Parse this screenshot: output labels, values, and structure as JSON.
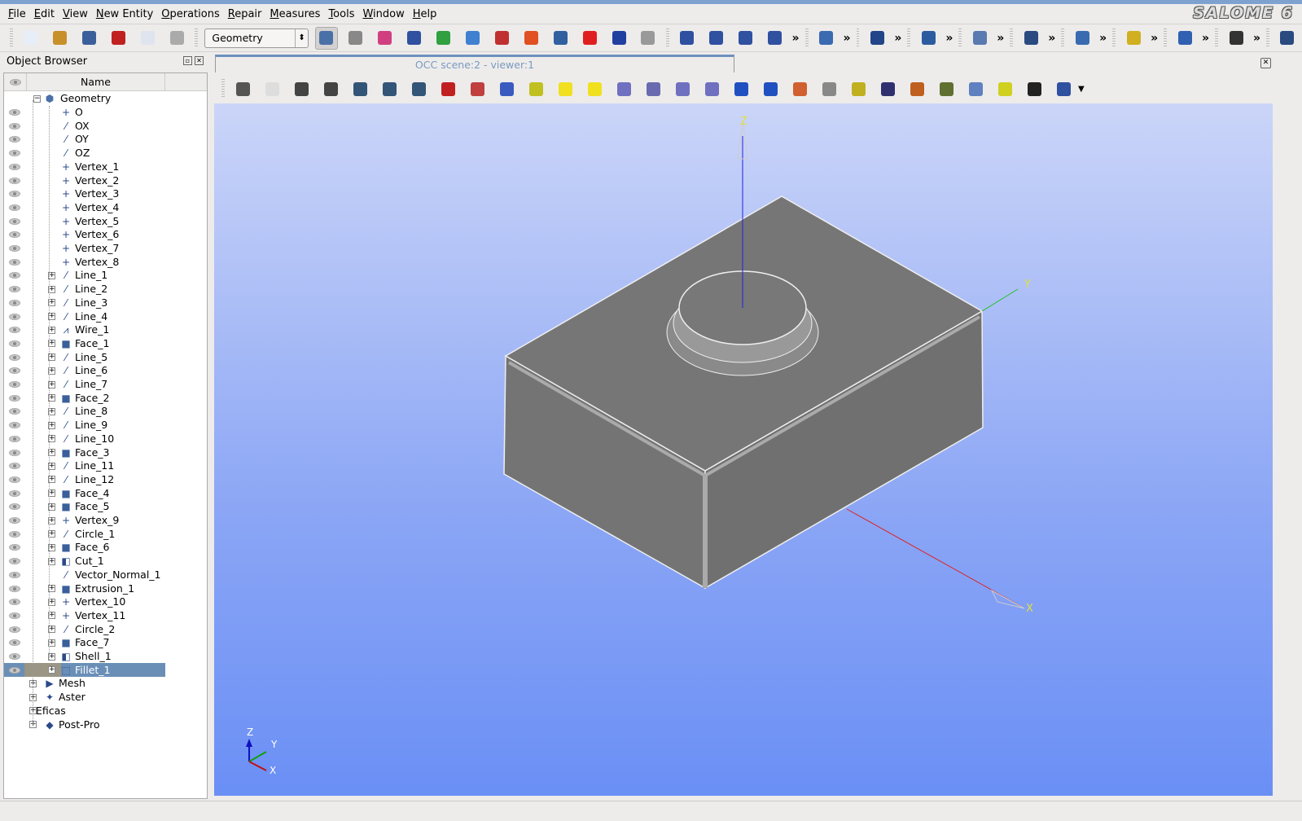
{
  "menu": [
    "File",
    "Edit",
    "View",
    "New Entity",
    "Operations",
    "Repair",
    "Measures",
    "Tools",
    "Window",
    "Help"
  ],
  "logo": "SALOME 6",
  "toolbar": {
    "file_icons": [
      {
        "name": "new-document-icon",
        "color": "#e8eef8"
      },
      {
        "name": "open-folder-icon",
        "color": "#c8902a"
      },
      {
        "name": "save-icon",
        "color": "#3b5f9a"
      },
      {
        "name": "close-icon",
        "color": "#c02020"
      },
      {
        "name": "copy-icon",
        "color": "#dfe4ee"
      },
      {
        "name": "paste-icon",
        "color": "#aaaaaa"
      }
    ],
    "module_select": "Geometry",
    "module_icons": [
      {
        "name": "geometry-module-icon",
        "color": "#4a70a8"
      },
      {
        "name": "smesh-module-icon",
        "color": "#888888"
      },
      {
        "name": "post-pro-module-icon",
        "color": "#d04080"
      },
      {
        "name": "yacs-module-icon",
        "color": "#3050a0"
      },
      {
        "name": "paravis-module-icon",
        "color": "#30a040"
      },
      {
        "name": "light-module-icon",
        "color": "#4080d0"
      },
      {
        "name": "homard-module-icon",
        "color": "#c03030"
      },
      {
        "name": "eficas-module-icon",
        "color": "#e05020"
      },
      {
        "name": "aster-module-icon",
        "color": "#3060a0"
      },
      {
        "name": "lobster-module-icon",
        "color": "#e02020"
      },
      {
        "name": "epx-module-icon",
        "color": "#2040a0"
      },
      {
        "name": "calculator-icon",
        "color": "#999999"
      }
    ],
    "geom_icons": [
      {
        "name": "point-icon",
        "color": "#3050a0"
      },
      {
        "name": "line-icon",
        "color": "#3050a0"
      },
      {
        "name": "circle-icon",
        "color": "#3050a0"
      },
      {
        "name": "plane-icon",
        "color": "#3050a0"
      },
      {
        "name": "box-icon",
        "color": "#3a6ab0"
      },
      {
        "name": "sphere-mesh-icon",
        "color": "#224488"
      },
      {
        "name": "boolean-icon",
        "color": "#2c5ca0"
      },
      {
        "name": "partition-icon",
        "color": "#5a7ab0"
      },
      {
        "name": "transform-icon",
        "color": "#2a4a80"
      },
      {
        "name": "solid-icon",
        "color": "#3a6ab0"
      },
      {
        "name": "fillet-2d-icon",
        "color": "#d0b020"
      },
      {
        "name": "edge-icon",
        "color": "#3060b0"
      },
      {
        "name": "vertex-small-icon",
        "color": "#333333"
      },
      {
        "name": "picture-icon",
        "color": "#2a4a80"
      }
    ],
    "more": "»"
  },
  "object_browser": {
    "title": "Object Browser",
    "column_name": "Name",
    "root": "Geometry",
    "children": [
      {
        "label": "O",
        "icon": "vertex",
        "expandable": false
      },
      {
        "label": "OX",
        "icon": "vector",
        "expandable": false
      },
      {
        "label": "OY",
        "icon": "vector",
        "expandable": false
      },
      {
        "label": "OZ",
        "icon": "vector",
        "expandable": false
      },
      {
        "label": "Vertex_1",
        "icon": "vertex",
        "expandable": false
      },
      {
        "label": "Vertex_2",
        "icon": "vertex",
        "expandable": false
      },
      {
        "label": "Vertex_3",
        "icon": "vertex",
        "expandable": false
      },
      {
        "label": "Vertex_4",
        "icon": "vertex",
        "expandable": false
      },
      {
        "label": "Vertex_5",
        "icon": "vertex",
        "expandable": false
      },
      {
        "label": "Vertex_6",
        "icon": "vertex",
        "expandable": false
      },
      {
        "label": "Vertex_7",
        "icon": "vertex",
        "expandable": false
      },
      {
        "label": "Vertex_8",
        "icon": "vertex",
        "expandable": false
      },
      {
        "label": "Line_1",
        "icon": "line",
        "expandable": true
      },
      {
        "label": "Line_2",
        "icon": "line",
        "expandable": true
      },
      {
        "label": "Line_3",
        "icon": "line",
        "expandable": true
      },
      {
        "label": "Line_4",
        "icon": "line",
        "expandable": true
      },
      {
        "label": "Wire_1",
        "icon": "wire",
        "expandable": true
      },
      {
        "label": "Face_1",
        "icon": "face",
        "expandable": true
      },
      {
        "label": "Line_5",
        "icon": "line",
        "expandable": true
      },
      {
        "label": "Line_6",
        "icon": "line",
        "expandable": true
      },
      {
        "label": "Line_7",
        "icon": "line",
        "expandable": true
      },
      {
        "label": "Face_2",
        "icon": "face",
        "expandable": true
      },
      {
        "label": "Line_8",
        "icon": "line",
        "expandable": true
      },
      {
        "label": "Line_9",
        "icon": "line",
        "expandable": true
      },
      {
        "label": "Line_10",
        "icon": "line",
        "expandable": true
      },
      {
        "label": "Face_3",
        "icon": "face",
        "expandable": true
      },
      {
        "label": "Line_11",
        "icon": "line",
        "expandable": true
      },
      {
        "label": "Line_12",
        "icon": "line",
        "expandable": true
      },
      {
        "label": "Face_4",
        "icon": "face",
        "expandable": true
      },
      {
        "label": "Face_5",
        "icon": "face",
        "expandable": true
      },
      {
        "label": "Vertex_9",
        "icon": "vertex",
        "expandable": true
      },
      {
        "label": "Circle_1",
        "icon": "line",
        "expandable": true
      },
      {
        "label": "Face_6",
        "icon": "face",
        "expandable": true
      },
      {
        "label": "Cut_1",
        "icon": "solid",
        "expandable": true
      },
      {
        "label": "Vector_Normal_1",
        "icon": "vector",
        "expandable": false
      },
      {
        "label": "Extrusion_1",
        "icon": "face",
        "expandable": true
      },
      {
        "label": "Vertex_10",
        "icon": "vertex",
        "expandable": true
      },
      {
        "label": "Vertex_11",
        "icon": "vertex",
        "expandable": true
      },
      {
        "label": "Circle_2",
        "icon": "line",
        "expandable": true
      },
      {
        "label": "Face_7",
        "icon": "face",
        "expandable": true
      },
      {
        "label": "Shell_1",
        "icon": "solid",
        "expandable": true
      },
      {
        "label": "Fillet_1",
        "icon": "fillet",
        "expandable": true,
        "selected": true
      }
    ],
    "modules": [
      {
        "label": "Mesh",
        "icon": "mesh"
      },
      {
        "label": "Aster",
        "icon": "aster"
      },
      {
        "label": "Eficas",
        "icon": ""
      },
      {
        "label": "Post-Pro",
        "icon": "postpro"
      }
    ]
  },
  "viewer": {
    "tab_title": "OCC scene:2 - viewer:1",
    "tools": [
      {
        "name": "dump-view-icon",
        "color": "#555555"
      },
      {
        "name": "mouse-mode-icon",
        "color": "#dddddd"
      },
      {
        "name": "show-trihedron-icon",
        "color": "#444444"
      },
      {
        "name": "axes-icon",
        "color": "#444444"
      },
      {
        "name": "fit-all-icon",
        "color": "#335577"
      },
      {
        "name": "fit-area-icon",
        "color": "#335577"
      },
      {
        "name": "zoom-icon",
        "color": "#335577"
      },
      {
        "name": "pan-icon",
        "color": "#c02020"
      },
      {
        "name": "global-pan-icon",
        "color": "#c04040"
      },
      {
        "name": "rotate-icon",
        "color": "#3a5ac0"
      },
      {
        "name": "rotation-point-icon",
        "color": "#c0c020"
      },
      {
        "name": "front-view-icon",
        "color": "#f0e020"
      },
      {
        "name": "back-view-icon",
        "color": "#f0e020"
      },
      {
        "name": "top-view-icon",
        "color": "#7070c0"
      },
      {
        "name": "bottom-view-icon",
        "color": "#6a6ab0"
      },
      {
        "name": "left-view-icon",
        "color": "#7070c0"
      },
      {
        "name": "right-view-icon",
        "color": "#7070c0"
      },
      {
        "name": "rotate-counterclockwise-icon",
        "color": "#2050c0"
      },
      {
        "name": "rotate-clockwise-icon",
        "color": "#2050c0"
      },
      {
        "name": "reset-view-icon",
        "color": "#d06030"
      },
      {
        "name": "memorize-view-icon",
        "color": "#888888"
      },
      {
        "name": "restore-view-icon",
        "color": "#c0b020"
      },
      {
        "name": "clone-view-icon",
        "color": "#303070"
      },
      {
        "name": "clipping-icon",
        "color": "#c06020"
      },
      {
        "name": "scaling-icon",
        "color": "#607030"
      },
      {
        "name": "graduated-axes-icon",
        "color": "#6080c0"
      },
      {
        "name": "ambient-light-icon",
        "color": "#d0d020"
      },
      {
        "name": "sync-view-icon",
        "color": "#222222"
      },
      {
        "name": "split-view-icon",
        "color": "#3050a0"
      }
    ],
    "axis_labels": {
      "x": "X",
      "y": "Y",
      "z": "Z"
    },
    "colors": {
      "bg_top": "#cbd5f8",
      "bg_bottom": "#6a8ff5",
      "shape": "#7a7a7a",
      "x": "#e02020",
      "y": "#20c020",
      "z": "#2020e0"
    }
  }
}
